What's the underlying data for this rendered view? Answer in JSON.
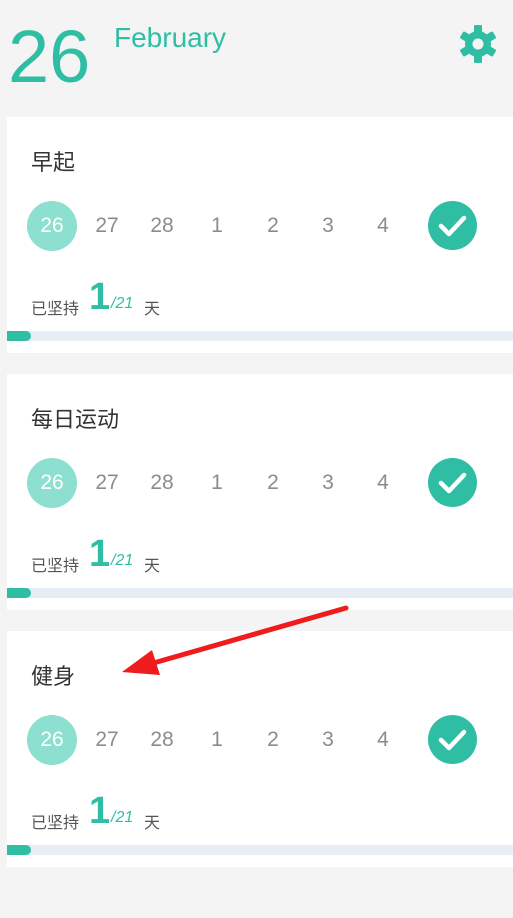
{
  "header": {
    "day": "26",
    "month": "February",
    "settings_icon": "gear-icon"
  },
  "colors": {
    "accent": "#2fbea4",
    "today_circle": "#8de0cf",
    "annotation_arrow": "#ee1c1c"
  },
  "cards": [
    {
      "title": "早起",
      "dates": [
        "26",
        "27",
        "28",
        "1",
        "2",
        "3",
        "4"
      ],
      "checked": true,
      "streak_prefix": "已坚持",
      "streak_count": "1",
      "streak_goal": "/21",
      "streak_suffix": "天",
      "progress": 0.048
    },
    {
      "title": "每日运动",
      "dates": [
        "26",
        "27",
        "28",
        "1",
        "2",
        "3",
        "4"
      ],
      "checked": true,
      "streak_prefix": "已坚持",
      "streak_count": "1",
      "streak_goal": "/21",
      "streak_suffix": "天",
      "progress": 0.048
    },
    {
      "title": "健身",
      "dates": [
        "26",
        "27",
        "28",
        "1",
        "2",
        "3",
        "4"
      ],
      "checked": true,
      "streak_prefix": "已坚持",
      "streak_count": "1",
      "streak_goal": "/21",
      "streak_suffix": "天",
      "progress": 0.048
    }
  ]
}
